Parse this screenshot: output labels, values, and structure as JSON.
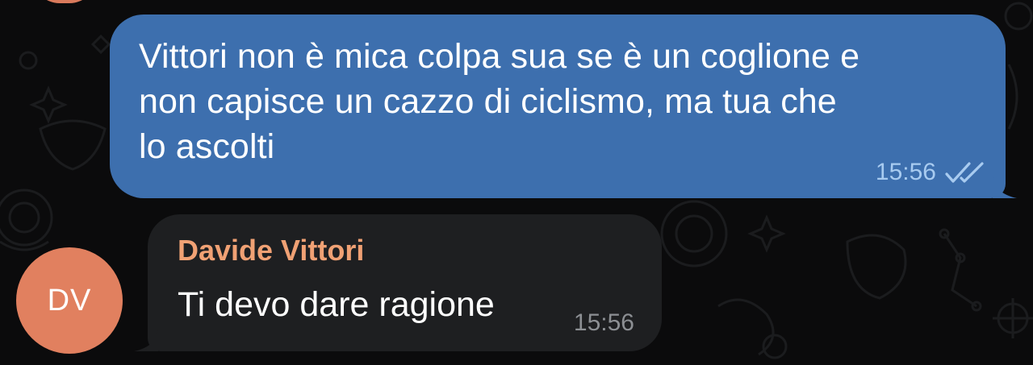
{
  "outgoing_message": {
    "text": "Vittori non è mica colpa sua se è un coglione e\nnon capisce un cazzo di ciclismo, ma tua che\nlo ascolti",
    "time": "15:56",
    "status_icon": "double-check-icon",
    "bubble_color": "#3d6fae"
  },
  "incoming_message": {
    "sender_name": "Davide Vittori",
    "sender_initials": "DV",
    "text": "Ti devo dare ragione",
    "time": "15:56",
    "avatar_color": "#e1805f",
    "name_color": "#f0a174",
    "bubble_color": "#1e1f21"
  }
}
